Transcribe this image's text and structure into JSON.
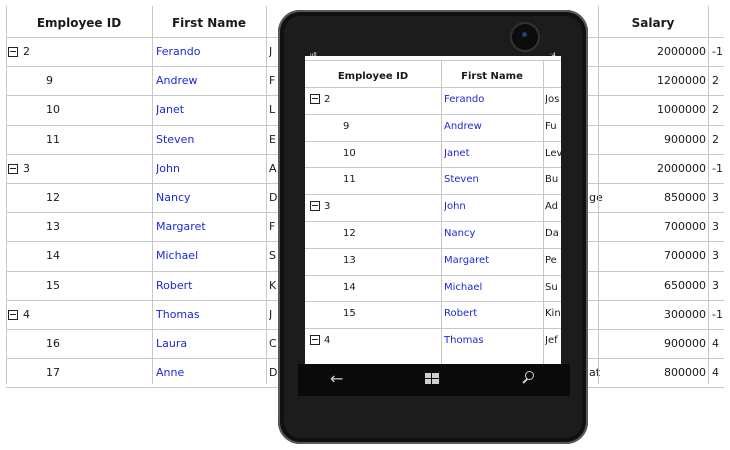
{
  "grid": {
    "headers": {
      "employee_id": "Employee ID",
      "first_name": "First Name",
      "salary": "Salary"
    },
    "rows": [
      {
        "id": "2",
        "group": true,
        "first": "Ferando",
        "initial": "J",
        "salary": "2000000",
        "rep": "-1"
      },
      {
        "id": "9",
        "group": false,
        "first": "Andrew",
        "initial": "F",
        "salary": "1200000",
        "rep": "2"
      },
      {
        "id": "10",
        "group": false,
        "first": "Janet",
        "initial": "L",
        "salary": "1000000",
        "rep": "2"
      },
      {
        "id": "11",
        "group": false,
        "first": "Steven",
        "initial": "E",
        "salary": "900000",
        "rep": "2"
      },
      {
        "id": "3",
        "group": true,
        "first": "John",
        "initial": "A",
        "salary": "2000000",
        "rep": "-1"
      },
      {
        "id": "12",
        "group": false,
        "first": "Nancy",
        "initial": "D",
        "salary": "850000",
        "rep": "3",
        "mid": "ge"
      },
      {
        "id": "13",
        "group": false,
        "first": "Margaret",
        "initial": "F",
        "salary": "700000",
        "rep": "3"
      },
      {
        "id": "14",
        "group": false,
        "first": "Michael",
        "initial": "S",
        "salary": "700000",
        "rep": "3"
      },
      {
        "id": "15",
        "group": false,
        "first": "Robert",
        "initial": "K",
        "salary": "650000",
        "rep": "3"
      },
      {
        "id": "4",
        "group": true,
        "first": "Thomas",
        "initial": "J",
        "salary": "300000",
        "rep": "-1"
      },
      {
        "id": "16",
        "group": false,
        "first": "Laura",
        "initial": "C",
        "salary": "900000",
        "rep": "4"
      },
      {
        "id": "17",
        "group": false,
        "first": "Anne",
        "initial": "D",
        "salary": "800000",
        "rep": "4",
        "mid": "at"
      }
    ]
  },
  "phone": {
    "status_left": "ııll",
    "status_right": ":4",
    "headers": {
      "employee_id": "Employee ID",
      "first_name": "First Name"
    },
    "rows": [
      {
        "id": "2",
        "group": true,
        "first": "Ferando",
        "last": "Jos"
      },
      {
        "id": "9",
        "group": false,
        "first": "Andrew",
        "last": "Fu"
      },
      {
        "id": "10",
        "group": false,
        "first": "Janet",
        "last": "Lev"
      },
      {
        "id": "11",
        "group": false,
        "first": "Steven",
        "last": "Bu"
      },
      {
        "id": "3",
        "group": true,
        "first": "John",
        "last": "Ad"
      },
      {
        "id": "12",
        "group": false,
        "first": "Nancy",
        "last": "Da"
      },
      {
        "id": "13",
        "group": false,
        "first": "Margaret",
        "last": "Pe"
      },
      {
        "id": "14",
        "group": false,
        "first": "Michael",
        "last": "Su"
      },
      {
        "id": "15",
        "group": false,
        "first": "Robert",
        "last": "Kin"
      },
      {
        "id": "4",
        "group": true,
        "first": "Thomas",
        "last": "Jef"
      }
    ],
    "nav": {
      "back": "←",
      "home": "⊞",
      "search": "⚲"
    }
  }
}
